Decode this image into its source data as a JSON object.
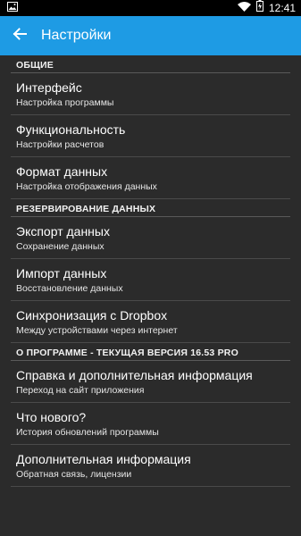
{
  "status_bar": {
    "time": "12:41",
    "icons": [
      "gallery-icon",
      "wifi-icon",
      "battery-charging-icon"
    ]
  },
  "app_bar": {
    "title": "Настройки",
    "back_icon": "arrow-left-icon"
  },
  "sections": [
    {
      "header": "ОБЩИЕ",
      "items": [
        {
          "title": "Интерфейс",
          "subtitle": "Настройка программы"
        },
        {
          "title": "Функциональность",
          "subtitle": "Настройки расчетов"
        },
        {
          "title": "Формат данных",
          "subtitle": "Настройка отображения данных"
        }
      ]
    },
    {
      "header": "РЕЗЕРВИРОВАНИЕ ДАННЫХ",
      "items": [
        {
          "title": "Экспорт данных",
          "subtitle": "Сохранение данных"
        },
        {
          "title": "Импорт данных",
          "subtitle": "Восстановление данных"
        },
        {
          "title": "Синхронизация с Dropbox",
          "subtitle": "Между устройствами через интернет"
        }
      ]
    },
    {
      "header": "О ПРОГРАММЕ - ТЕКУЩАЯ ВЕРСИЯ 16.53 PRO",
      "items": [
        {
          "title": "Справка и дополнительная информация",
          "subtitle": "Переход на сайт приложения"
        },
        {
          "title": "Что нового?",
          "subtitle": "История обновлений программы"
        },
        {
          "title": "Дополнительная информация",
          "subtitle": "Обратная связь, лицензии"
        }
      ]
    }
  ]
}
